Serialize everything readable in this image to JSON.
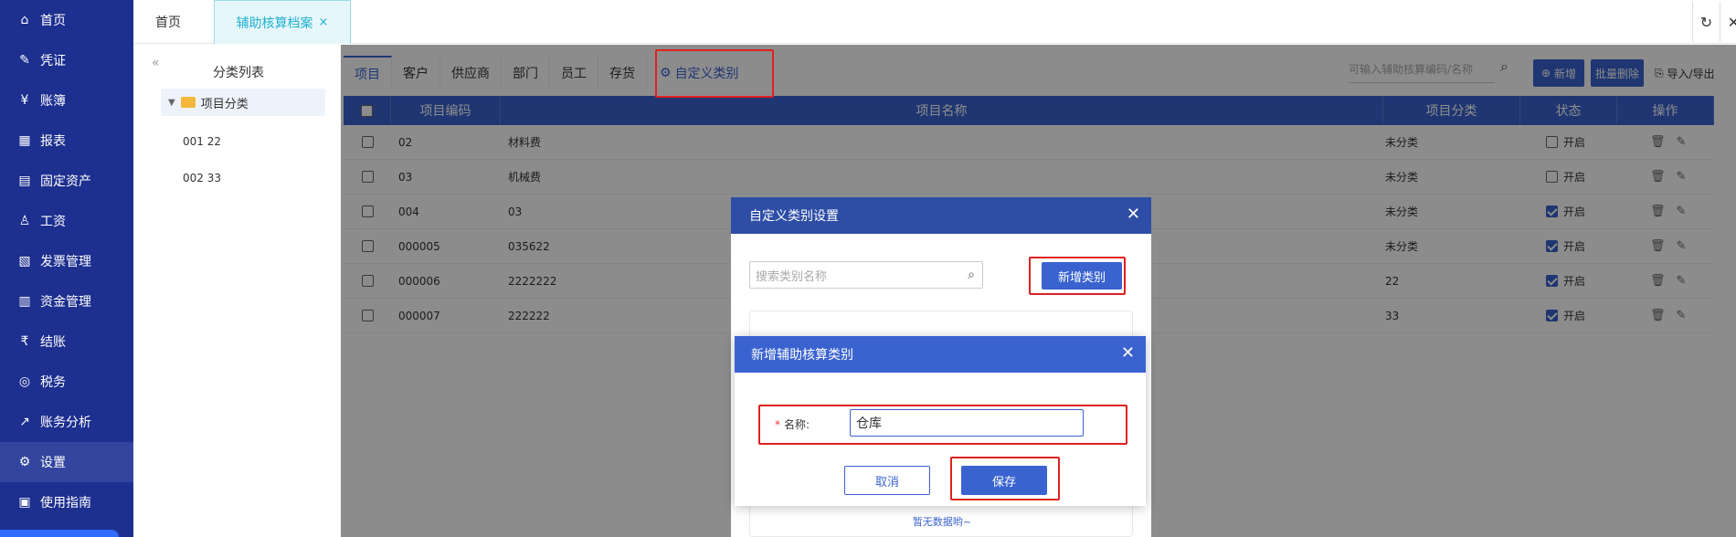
{
  "sidebar": {
    "items": [
      {
        "label": "首页",
        "icon": "home-icon",
        "glyph": "⌂"
      },
      {
        "label": "凭证",
        "icon": "voucher-icon",
        "glyph": "✎"
      },
      {
        "label": "账簿",
        "icon": "yen-icon",
        "glyph": "¥"
      },
      {
        "label": "报表",
        "icon": "report-icon",
        "glyph": "▦"
      },
      {
        "label": "固定资产",
        "icon": "asset-icon",
        "glyph": "▤"
      },
      {
        "label": "工资",
        "icon": "salary-icon",
        "glyph": "♙"
      },
      {
        "label": "发票管理",
        "icon": "invoice-icon",
        "glyph": "▧"
      },
      {
        "label": "资金管理",
        "icon": "fund-icon",
        "glyph": "▥"
      },
      {
        "label": "结账",
        "icon": "checkout-icon",
        "glyph": "₹"
      },
      {
        "label": "税务",
        "icon": "tax-icon",
        "glyph": "◎"
      },
      {
        "label": "账务分析",
        "icon": "analysis-icon",
        "glyph": "↗"
      },
      {
        "label": "设置",
        "icon": "gear-icon",
        "glyph": "⚙"
      },
      {
        "label": "使用指南",
        "icon": "guide-icon",
        "glyph": "▣"
      }
    ]
  },
  "topbar": {
    "home_tab": "首页",
    "active_tab": "辅助核算档案",
    "close_glyph": "×",
    "refresh_glyph": "↻",
    "close_all_glyph": "✕"
  },
  "left_panel": {
    "collapse_glyph": "«",
    "title": "分类列表",
    "root": "项目分类",
    "items": [
      "001 22",
      "002 33"
    ]
  },
  "tabs": [
    "项目",
    "客户",
    "供应商",
    "部门",
    "员工",
    "存货"
  ],
  "custom_tab": "自定义类别",
  "toolbar": {
    "search_placeholder": "可输入辅助核算编码/名称",
    "new_label": "新增",
    "batch_delete_label": "批量删除",
    "import_export_label": "导入/导出"
  },
  "table": {
    "headers": [
      "项目编码",
      "项目名称",
      "项目分类",
      "状态",
      "操作"
    ],
    "rows": [
      {
        "code": "02",
        "name": "材料费",
        "category": "未分类",
        "status": "开启",
        "enabled": false
      },
      {
        "code": "03",
        "name": "机械费",
        "category": "未分类",
        "status": "开启",
        "enabled": false
      },
      {
        "code": "004",
        "name": "03",
        "category": "未分类",
        "status": "开启",
        "enabled": true
      },
      {
        "code": "000005",
        "name": "035622",
        "category": "未分类",
        "status": "开启",
        "enabled": true
      },
      {
        "code": "000006",
        "name": "2222222",
        "category": "22",
        "status": "开启",
        "enabled": true
      },
      {
        "code": "000007",
        "name": "222222",
        "category": "33",
        "status": "开启",
        "enabled": true
      }
    ]
  },
  "dialog1": {
    "title": "自定义类别设置",
    "search_placeholder": "搜索类别名称",
    "add_label": "新增类别",
    "empty_text": "暂无数据哟~"
  },
  "dialog2": {
    "title": "新增辅助核算类别",
    "required_mark": "*",
    "name_label": "名称:",
    "name_value": "仓库",
    "cancel_label": "取消",
    "save_label": "保存"
  },
  "colors": {
    "sidebar_bg": "#1d2f8f",
    "accent": "#3a63d0",
    "highlight": "#e02020"
  }
}
